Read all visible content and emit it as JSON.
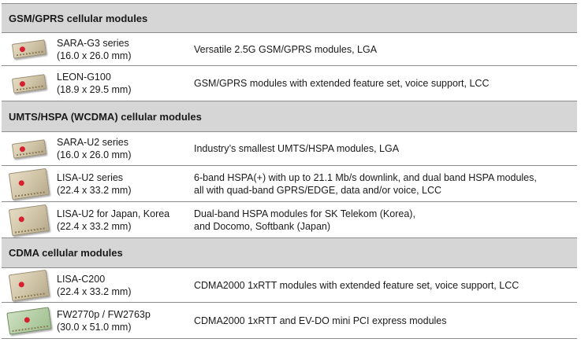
{
  "sections": [
    {
      "title": "GSM/GPRS cellular modules",
      "rows": [
        {
          "name": "SARA-G3 series",
          "size": "(16.0 x 26.0 mm)",
          "desc": [
            "Versatile 2.5G GSM/GPRS modules, LGA"
          ],
          "icon": "sara-module-icon"
        },
        {
          "name": "LEON-G100",
          "size": "(18.9 x 29.5 mm)",
          "desc": [
            "GSM/GPRS modules with extended feature set, voice support, LCC"
          ],
          "icon": "leon-module-icon"
        }
      ]
    },
    {
      "title": "UMTS/HSPA (WCDMA) cellular modules",
      "rows": [
        {
          "name": "SARA-U2 series",
          "size": "(16.0 x 26.0 mm)",
          "desc": [
            "Industry’s smallest UMTS/HSPA modules, LGA"
          ],
          "icon": "sara-module-icon"
        },
        {
          "name": "LISA-U2 series",
          "size": "(22.4 x 33.2 mm)",
          "desc": [
            "6-band HSPA(+) with up to 21.1 Mb/s downlink, and dual band HSPA modules,",
            "all with quad-band GPRS/EDGE, data and/or voice, LCC"
          ],
          "icon": "lisa-module-icon"
        },
        {
          "name": "LISA-U2 for Japan, Korea",
          "size": "(22.4 x 33.2 mm)",
          "desc": [
            "Dual-band HSPA modules for SK Telekom (Korea),",
            "and Docomo, Softbank (Japan)"
          ],
          "icon": "lisa-module-icon"
        }
      ]
    },
    {
      "title": "CDMA cellular modules",
      "rows": [
        {
          "name": "LISA-C200",
          "size": "(22.4 x 33.2 mm)",
          "desc": [
            "CDMA2000 1xRTT modules with extended feature set, voice support, LCC"
          ],
          "icon": "lisa-module-icon"
        },
        {
          "name": "FW2770p / FW2763p",
          "size": "(30.0 x 51.0 mm)",
          "desc": [
            "CDMA2000 1xRTT and EV-DO mini PCI express modules"
          ],
          "icon": "mini-pci-card-icon"
        }
      ]
    }
  ]
}
